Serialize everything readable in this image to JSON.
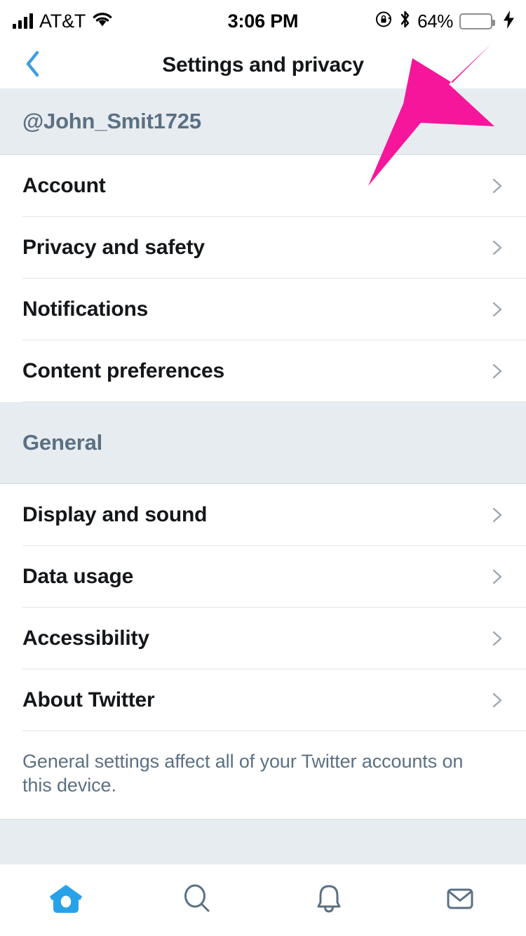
{
  "status_bar": {
    "carrier": "AT&T",
    "time": "3:06 PM",
    "battery_percent": "64%",
    "battery_level": 64,
    "icons": [
      "signal-bars-icon",
      "wifi-icon",
      "rotation-lock-icon",
      "bluetooth-icon",
      "battery-icon",
      "charging-bolt-icon"
    ]
  },
  "nav": {
    "title": "Settings and privacy",
    "back_icon": "back-chevron-icon"
  },
  "account_section": {
    "header": "@John_Smit1725",
    "items": [
      {
        "label": "Account"
      },
      {
        "label": "Privacy and safety"
      },
      {
        "label": "Notifications"
      },
      {
        "label": "Content preferences"
      }
    ]
  },
  "general_section": {
    "header": "General",
    "items": [
      {
        "label": "Display and sound"
      },
      {
        "label": "Data usage"
      },
      {
        "label": "Accessibility"
      },
      {
        "label": "About Twitter"
      }
    ],
    "footnote": "General settings affect all of your Twitter accounts on this device."
  },
  "tab_bar": {
    "tabs": [
      {
        "name": "home-tab",
        "icon": "home-birdhouse-icon",
        "active": true
      },
      {
        "name": "search-tab",
        "icon": "search-icon",
        "active": false
      },
      {
        "name": "notifications-tab",
        "icon": "bell-icon",
        "active": false
      },
      {
        "name": "messages-tab",
        "icon": "envelope-icon",
        "active": false
      }
    ]
  },
  "annotation": {
    "type": "arrow",
    "color": "#F5169B",
    "points_to": "Account"
  },
  "colors": {
    "accent_blue": "#3E9DE0",
    "tab_active": "#27A2E8",
    "section_bg": "#E7ECF0",
    "muted_text": "#5B7083",
    "primary_text": "#14171a",
    "separator": "#dfe5e8",
    "battery_green": "#4CD964",
    "annotation_pink": "#F5169B"
  }
}
